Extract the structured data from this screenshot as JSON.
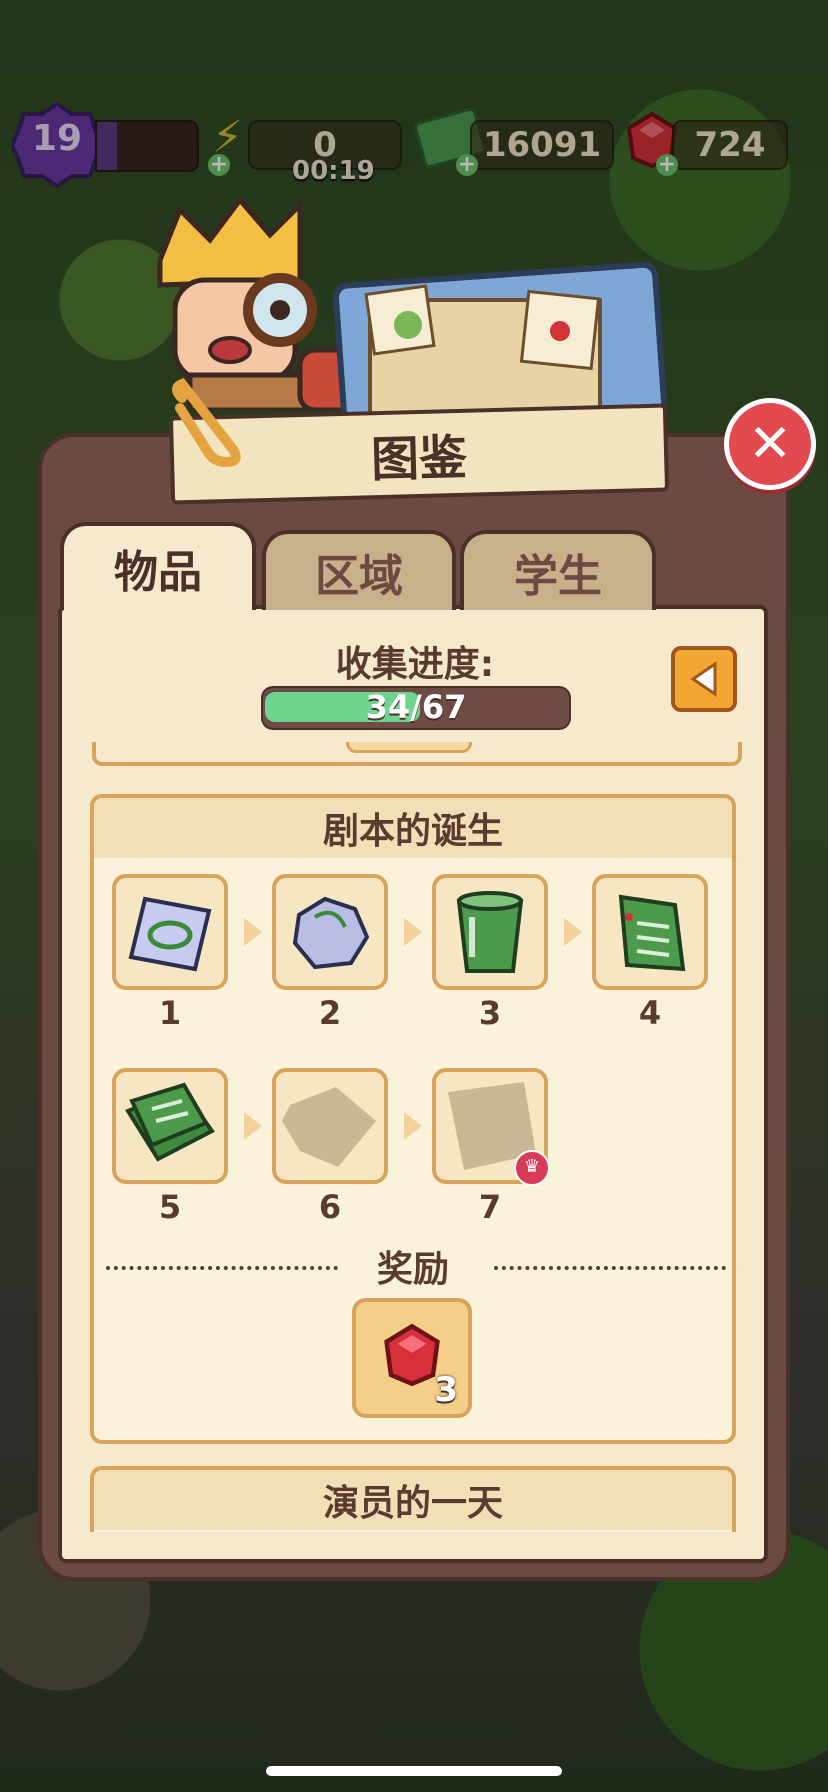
{
  "hud": {
    "level": "19",
    "energy": "0",
    "energy_timer": "00:19",
    "cash": "16091",
    "gems": "724"
  },
  "panel": {
    "title": "图鉴",
    "tabs": [
      "物品",
      "区域",
      "学生"
    ],
    "active_tab": 0,
    "progress_label": "收集进度:",
    "progress_text": "34/67",
    "progress_fraction": 0.507
  },
  "collections": [
    {
      "title": "剧本的诞生",
      "items": [
        "1",
        "2",
        "3",
        "4",
        "5",
        "6",
        "7"
      ],
      "reward_label": "奖励",
      "reward_count": "3"
    },
    {
      "title": "演员的一天"
    }
  ],
  "colors": {
    "accent_orange": "#f2a633",
    "progress_green": "#6ed58f",
    "close_red": "#e34a4f",
    "panel_brown": "#6b4a43"
  },
  "icons": [
    "level-badge-icon",
    "energy-icon",
    "cash-icon",
    "gem-icon",
    "close-icon",
    "back-arrow-icon",
    "paper-icon",
    "crumpled-paper-icon",
    "trash-can-icon",
    "script-icon",
    "script-stack-icon",
    "locked-item-icon",
    "crown-icon",
    "ruby-icon"
  ]
}
